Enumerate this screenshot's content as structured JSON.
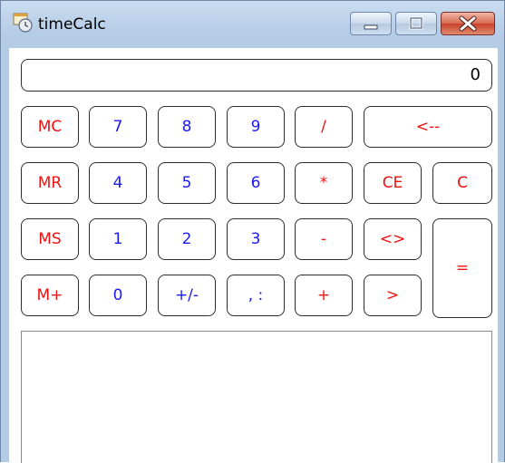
{
  "window": {
    "title": "timeCalc"
  },
  "caption_buttons": {
    "minimize_icon": "minimize-icon",
    "maximize_icon": "maximize-icon",
    "close_icon": "close-icon"
  },
  "display": {
    "value": "0"
  },
  "keys": {
    "mc": "MC",
    "mr": "MR",
    "ms": "MS",
    "mplus": "M+",
    "k7": "7",
    "k8": "8",
    "k9": "9",
    "k4": "4",
    "k5": "5",
    "k6": "6",
    "k1": "1",
    "k2": "2",
    "k3": "3",
    "k0": "0",
    "plusminus": "+/-",
    "sep": ", :",
    "div": "/",
    "mul": "*",
    "sub": "-",
    "add": "+",
    "back": "<--",
    "ce": "CE",
    "c": "C",
    "swap": "<>",
    "gt": ">",
    "eq": "="
  },
  "colors": {
    "memory_and_ops": "#ee1111",
    "digits": "#1a1aee"
  }
}
